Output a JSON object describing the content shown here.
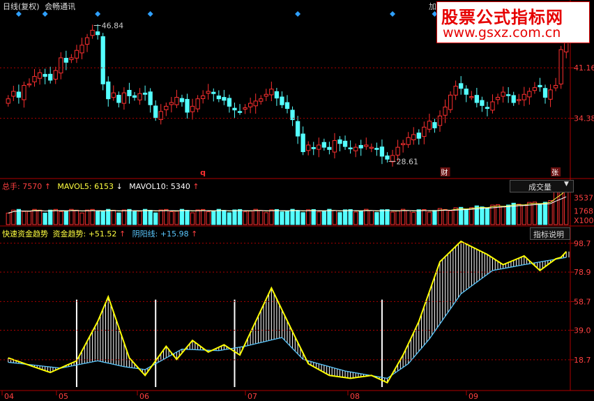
{
  "header": {
    "period": "日线(复权)",
    "stock_name": "会畅通讯",
    "corner_tab": "加"
  },
  "watermark": {
    "title": "股票公式指标网",
    "url": "www.gsxz.com.cn",
    "colors": {
      "text": "#e60000",
      "background": "#ffffff"
    }
  },
  "price_panel": {
    "y_labels": [
      "41.16",
      "34.38"
    ],
    "high_marker": "46.84",
    "low_marker": "28.61",
    "event_markers": [
      "q",
      "财",
      "张"
    ],
    "colors": {
      "up": "#ff3030",
      "down": "#54ffff",
      "diamond": "#2fa0ff",
      "grid": "#b00000"
    }
  },
  "volume_panel": {
    "title": "总手",
    "total": "7570",
    "mavol5_label": "MAVOL5:",
    "mavol5": "6153",
    "mavol10_label": "MAVOL10:",
    "mavol10": "5340",
    "dropdown_label": "成交量",
    "y_labels": [
      "3537",
      "1768",
      "X100"
    ]
  },
  "indicator_panel": {
    "title": "快速资金趋势",
    "trend_label": "资金趋势:",
    "trend_value": "+51.52",
    "yinyang_label": "阴阳线:",
    "yinyang_value": "+15.98",
    "help_button": "指标说明",
    "y_labels": [
      "98.7",
      "78.9",
      "58.7",
      "39.0",
      "18.7"
    ],
    "colors": {
      "trend": "#ffff00",
      "baseline": "#5ac8ff",
      "bars": "#ffffff"
    }
  },
  "x_axis": {
    "months": [
      "04",
      "05",
      "06",
      "07",
      "08",
      "09"
    ]
  },
  "icons": {
    "arrow_up": "arrow-up-icon",
    "arrow_down": "arrow-down-icon",
    "dropdown": "dropdown-triangle-icon"
  },
  "chart_data": {
    "type": "candlestick",
    "months": [
      "04",
      "05",
      "06",
      "07",
      "08",
      "09"
    ],
    "price": {
      "y_ticks": [
        41.16,
        34.38
      ],
      "high": 46.84,
      "low": 28.61,
      "closes": [
        37,
        38,
        37.2,
        38.8,
        39,
        40,
        40.5,
        40,
        39.5,
        40.8,
        42.5,
        41.9,
        42.5,
        43.5,
        44.2,
        45.2,
        46.2,
        45.6,
        39,
        37,
        37.8,
        36.5,
        37.8,
        37.4,
        37.2,
        37.7,
        37.6,
        36.2,
        34.5,
        35.3,
        36,
        36.5,
        37.2,
        36.6,
        35.2,
        36,
        37,
        37.4,
        38,
        37.7,
        37,
        36.8,
        36,
        35.5,
        35.3,
        35.8,
        36.4,
        36.7,
        37,
        37.6,
        38.3,
        37.1,
        36.2,
        35.7,
        34.2,
        32,
        29.9,
        30.8,
        30.3,
        30.8,
        30.5,
        30.2,
        31.4,
        31,
        30.6,
        30.3,
        30.5,
        30.4,
        30.8,
        30.5,
        30.2,
        29.3,
        28.9,
        29.4,
        30.5,
        31,
        31.8,
        32.2,
        31.7,
        33.2,
        34,
        33.1,
        34.7,
        35.9,
        37.5,
        38.7,
        38.4,
        37.6,
        37.3,
        36.5,
        36.1,
        35.7,
        36.6,
        37.2,
        37.9,
        37.5,
        36.5,
        36.9,
        37.6,
        38,
        38.5,
        38.6,
        37.2,
        38.2,
        38.8,
        43.6,
        44.5
      ]
    },
    "volume": {
      "y_ticks": [
        3537,
        1768
      ],
      "unit": "X100",
      "latest": 7570,
      "mavol5": 6153,
      "mavol10": 5340
    },
    "indicator": {
      "y_ticks": [
        98.7,
        78.9,
        58.7,
        39.0,
        18.7
      ],
      "trend_latest": 51.52,
      "yinyang_latest": 15.98,
      "trend_keypoints": [
        [
          0,
          20
        ],
        [
          8,
          10
        ],
        [
          13,
          18
        ],
        [
          17,
          45
        ],
        [
          19,
          62
        ],
        [
          23,
          20
        ],
        [
          26,
          8
        ],
        [
          30,
          28
        ],
        [
          32,
          19
        ],
        [
          35,
          32
        ],
        [
          38,
          24
        ],
        [
          41,
          29
        ],
        [
          44,
          22
        ],
        [
          47,
          45
        ],
        [
          50,
          68
        ],
        [
          54,
          38
        ],
        [
          57,
          16
        ],
        [
          61,
          8
        ],
        [
          65,
          6
        ],
        [
          69,
          8
        ],
        [
          72,
          3
        ],
        [
          75,
          22
        ],
        [
          78,
          45
        ],
        [
          82,
          86
        ],
        [
          86,
          100
        ],
        [
          91,
          91
        ],
        [
          94,
          84
        ],
        [
          98,
          90
        ],
        [
          101,
          80
        ],
        [
          104,
          88
        ],
        [
          105,
          89
        ],
        [
          106,
          93
        ]
      ],
      "baseline_keypoints": [
        [
          0,
          17
        ],
        [
          10,
          13
        ],
        [
          17,
          18
        ],
        [
          22,
          14
        ],
        [
          26,
          12
        ],
        [
          33,
          26
        ],
        [
          40,
          25
        ],
        [
          45,
          28
        ],
        [
          52,
          34
        ],
        [
          56,
          19
        ],
        [
          64,
          11
        ],
        [
          72,
          6
        ],
        [
          76,
          16
        ],
        [
          80,
          33
        ],
        [
          86,
          64
        ],
        [
          92,
          80
        ],
        [
          98,
          84
        ],
        [
          106,
          89
        ]
      ],
      "signal_bars": [
        13,
        28,
        43,
        71
      ]
    }
  }
}
